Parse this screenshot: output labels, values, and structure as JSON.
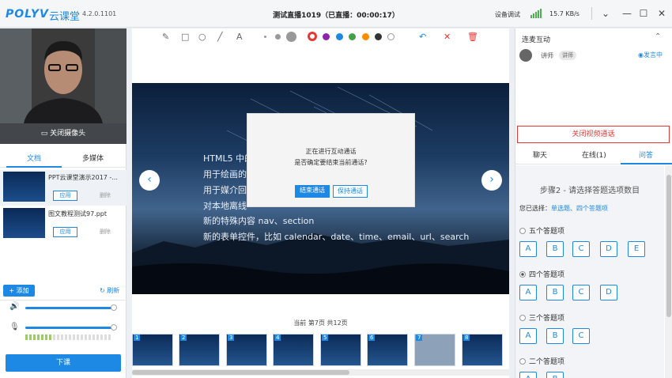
{
  "window": {
    "logo": "POLYV",
    "logo_cn": "云课堂",
    "version": "4.2.0.1101",
    "title": "测试直播1019（已直播：00:00:17）",
    "device_test": "设备调试",
    "net_speed": "15.7 KB/s",
    "icons": [
      "signal-icon",
      "dropdown-icon",
      "minimize-icon",
      "maximize-icon",
      "close-icon"
    ]
  },
  "left": {
    "camera_close": "关闭摄像头",
    "tabs": [
      "文档",
      "多媒体"
    ],
    "docs": [
      {
        "name": "PPT云课堂演示2017 -...",
        "apply": "应用",
        "delete": "删除"
      },
      {
        "name": "图文教程测试97.ppt",
        "apply": "应用",
        "delete": "删除"
      }
    ],
    "add": "+ 添加",
    "refresh": "刷新",
    "speaker_volume": 1.0,
    "mic_volume": 1.0,
    "end_class": "下课"
  },
  "center": {
    "tools": [
      "pencil-icon",
      "rectangle-icon",
      "circle-icon",
      "line-icon",
      "text-icon"
    ],
    "sizes": [
      "small",
      "medium",
      "large"
    ],
    "colors": [
      "#e53935",
      "#8e24aa",
      "#1e88e5",
      "#43a047",
      "#fb8c00",
      "#333333",
      "#ffffff"
    ],
    "slide_lines": [
      "HTML5 中的",
      "用于绘画的",
      "用于媒介回",
      "对本地离线",
      "新的特殊内容                                     nav、section",
      "新的表单控件，比如 calendar、date、time、email、url、search"
    ],
    "dialog": {
      "line1": "正在进行互动通话",
      "line2": "是否确定要结束当前通话?",
      "end_call": "结束通话",
      "keep_call": "保持通话"
    },
    "page_info": "当前 第7页  共12页",
    "thumbs": [
      "1",
      "2",
      "3",
      "4",
      "5",
      "6",
      "7",
      "8"
    ]
  },
  "right": {
    "header": "连麦互动",
    "role": "讲师",
    "badge": "讲师",
    "mic": "发言中",
    "close_video": "关闭视频通话",
    "tabs": [
      "聊天",
      "在线(1)",
      "问答"
    ],
    "step": "步骤2 - 请选择答题选项数目",
    "chosen_label": "您已选择：",
    "chosen_value": "单选题、四个答题项",
    "options": [
      {
        "label": "五个答题项",
        "letters": [
          "A",
          "B",
          "C",
          "D",
          "E"
        ],
        "selected": false
      },
      {
        "label": "四个答题项",
        "letters": [
          "A",
          "B",
          "C",
          "D"
        ],
        "selected": true
      },
      {
        "label": "三个答题项",
        "letters": [
          "A",
          "B",
          "C"
        ],
        "selected": false
      },
      {
        "label": "二个答题项",
        "letters": [
          "A",
          "B"
        ],
        "selected": false
      }
    ]
  }
}
